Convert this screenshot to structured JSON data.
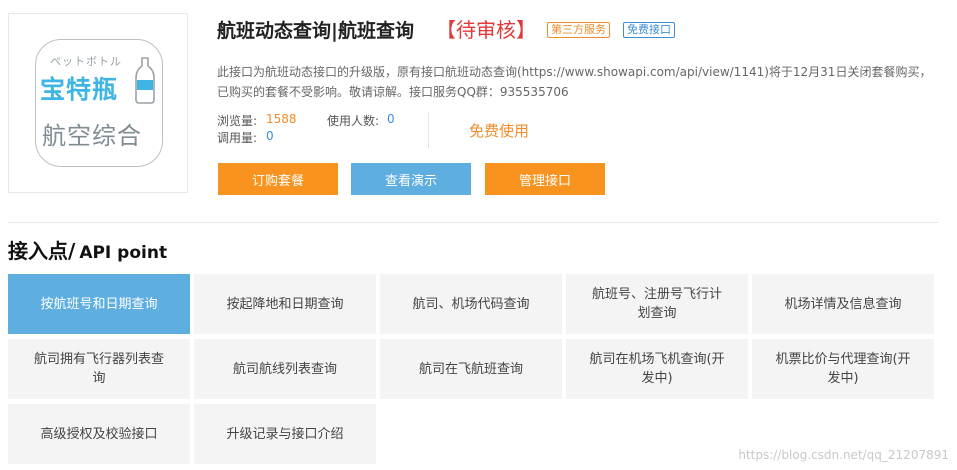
{
  "logo": {
    "jp_text": "ペットボトル",
    "brand_text": "宝特瓶",
    "sub_text": "航空综合",
    "icon": "bottle-icon"
  },
  "header": {
    "title": "航班动态查询|航班查询",
    "status": "【待审核】",
    "badge_third": "第三方服务",
    "badge_free": "免费接口"
  },
  "description": "此接口为航班动态接口的升级版，原有接口航班动态查询(https://www.showapi.com/api/view/1141)将于12月31日关闭套餐购买，已购买的套餐不受影响。敬请谅解。接口服务QQ群：935535706",
  "stats": {
    "views_label": "浏览量:",
    "views_value": "1588",
    "calls_label": "调用量:",
    "calls_value": "0",
    "users_label": "使用人数:",
    "users_value": "0",
    "free_use": "免费使用"
  },
  "buttons": {
    "subscribe": "订购套餐",
    "demo": "查看演示",
    "manage": "管理接口"
  },
  "section": {
    "title_zh": "接入点/",
    "title_en": "API point"
  },
  "api_points": [
    {
      "label": "按航班号和日期查询",
      "active": true
    },
    {
      "label": "按起降地和日期查询",
      "active": false
    },
    {
      "label": "航司、机场代码查询",
      "active": false
    },
    {
      "label": "航班号、注册号飞行计划查询",
      "active": false
    },
    {
      "label": "机场详情及信息查询",
      "active": false
    },
    {
      "label": "航司拥有飞行器列表查询",
      "active": false
    },
    {
      "label": "航司航线列表查询",
      "active": false
    },
    {
      "label": "航司在飞航班查询",
      "active": false
    },
    {
      "label": "航司在机场飞机查询(开发中)",
      "active": false
    },
    {
      "label": "机票比价与代理查询(开发中)",
      "active": false
    },
    {
      "label": "高级授权及校验接口",
      "active": false
    },
    {
      "label": "升级记录与接口介绍",
      "active": false
    }
  ],
  "watermark": "https://blog.csdn.net/qq_21207891",
  "colors": {
    "accent_orange": "#f7931e",
    "accent_blue": "#5eaee0",
    "status_red": "#e23a3a"
  }
}
